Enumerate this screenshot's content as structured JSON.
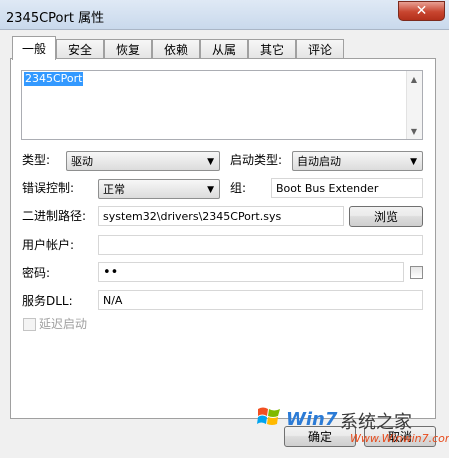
{
  "window": {
    "title": "2345CPort 属性",
    "close_label": "✕"
  },
  "tabs": [
    {
      "label": "一般",
      "active": true
    },
    {
      "label": "安全",
      "active": false
    },
    {
      "label": "恢复",
      "active": false
    },
    {
      "label": "依赖",
      "active": false
    },
    {
      "label": "从属",
      "active": false
    },
    {
      "label": "其它",
      "active": false
    },
    {
      "label": "评论",
      "active": false
    }
  ],
  "general": {
    "description_value": "2345CPort",
    "type_label": "类型:",
    "type_value": "驱动",
    "start_type_label": "启动类型:",
    "start_type_value": "自动启动",
    "error_control_label": "错误控制:",
    "error_control_value": "正常",
    "group_label": "组:",
    "group_value": "Boot Bus Extender",
    "binary_path_label": "二进制路径:",
    "binary_path_value": "system32\\drivers\\2345CPort.sys",
    "browse_label": "浏览",
    "user_account_label": "用户帐户:",
    "user_account_value": "",
    "password_label": "密码:",
    "password_value": "••",
    "service_dll_label": "服务DLL:",
    "service_dll_value": "N/A",
    "delayed_start_label": "延迟启动"
  },
  "footer": {
    "ok_label": "确定",
    "cancel_label": "取消"
  },
  "watermark": {
    "brand": "Win7",
    "site_name": "系统之家",
    "url": "Www.Winwin7.com"
  },
  "colors": {
    "selection": "#3399ff",
    "watermark_blue": "#2b7bd6",
    "watermark_orange": "#e84b1c"
  },
  "icons": {
    "close": "close-icon",
    "dropdown": "chevron-down-icon",
    "logo": "windows-logo-icon"
  }
}
